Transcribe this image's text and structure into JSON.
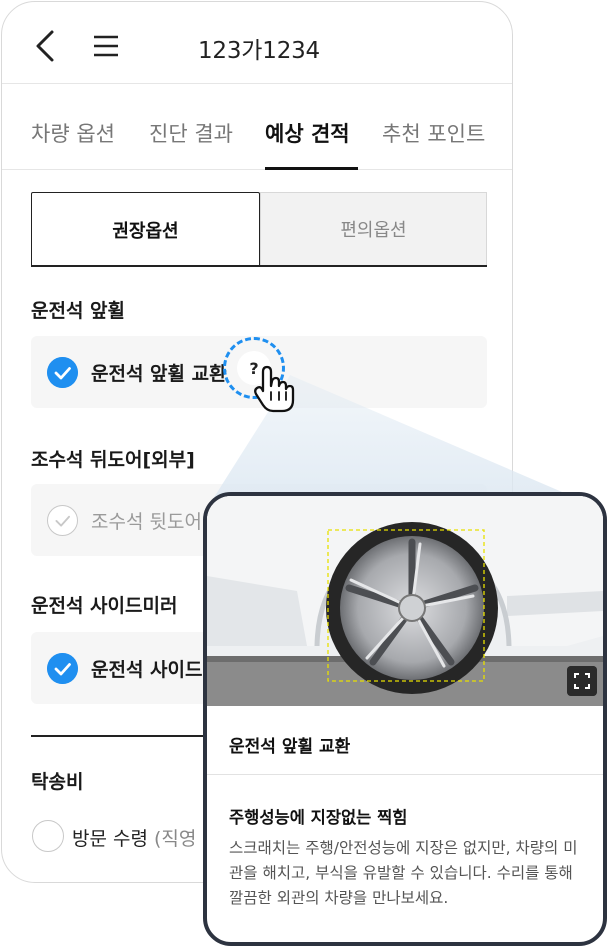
{
  "header": {
    "plate_number": "123가1234"
  },
  "tabs": [
    {
      "label": "차량 옵션"
    },
    {
      "label": "진단 결과"
    },
    {
      "label": "예상 견적"
    },
    {
      "label": "추천 포인트"
    }
  ],
  "active_tab": "예상 견적",
  "segments": {
    "recommended": "권장옵션",
    "convenience": "편의옵션"
  },
  "sections": [
    {
      "title": "운전석 앞휠",
      "option": "운전석 앞휠 교환",
      "checked": true
    },
    {
      "title": "조수석 뒤도어[외부]",
      "option": "조수석 뒷도어",
      "checked": false
    },
    {
      "title": "운전석 사이드미러",
      "option": "운전석 사이드",
      "checked": true
    }
  ],
  "towing": {
    "title": "탁송비",
    "option_main": "방문 수령",
    "option_sub": "(직영"
  },
  "help": {
    "symbol": "?"
  },
  "popup": {
    "title": "운전석 앞휠 교환",
    "heading": "주행성능에 지장없는 찍힘",
    "description": "스크래치는 주행/안전성능에 지장은 없지만, 차량의 미관을 해치고, 부식을 유발할 수 있습니다. 수리를 통해 깔끔한 외관의 차량을 만나보세요."
  },
  "colors": {
    "accent": "#1f8ff0",
    "popup_border": "#2d3340",
    "highlight_box": "#e8e000"
  }
}
